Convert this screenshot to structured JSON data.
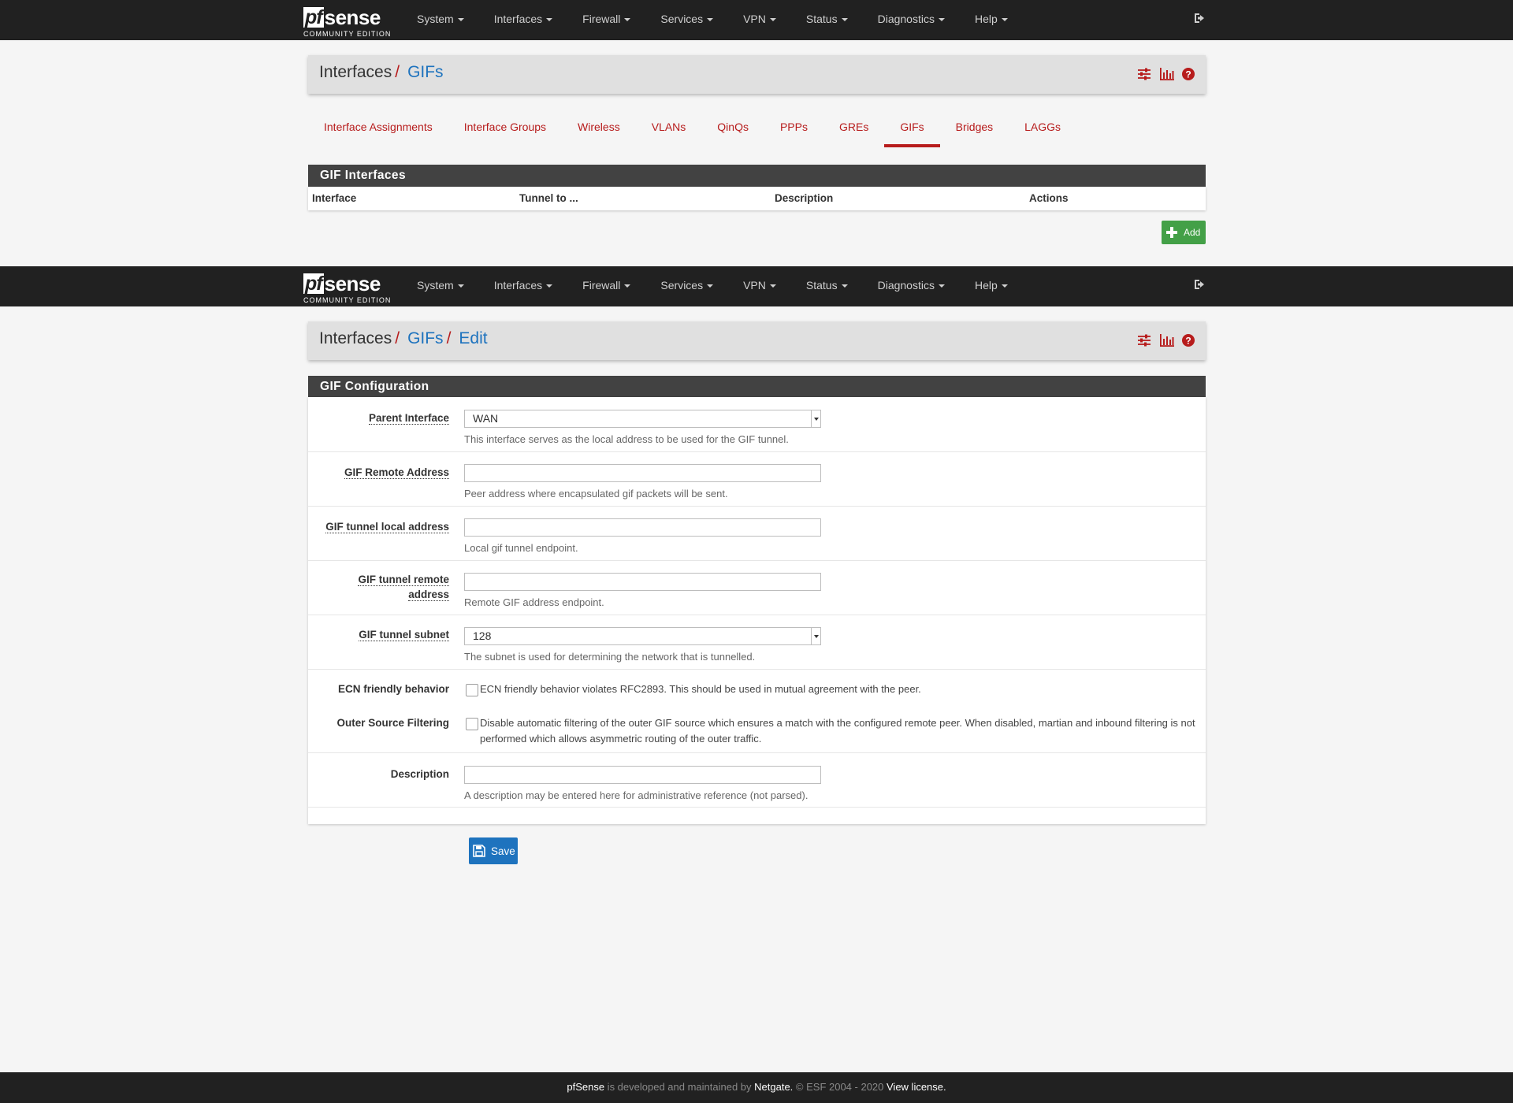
{
  "nav": {
    "brand_pf": "pf",
    "brand_sense": "sense",
    "brand_edition": "COMMUNITY EDITION",
    "menu": [
      "System",
      "Interfaces",
      "Firewall",
      "Services",
      "VPN",
      "Status",
      "Diagnostics",
      "Help"
    ]
  },
  "list_page": {
    "breadcrumb": {
      "root": "Interfaces",
      "sep": "/",
      "current": "GIFs"
    },
    "tabs": [
      "Interface Assignments",
      "Interface Groups",
      "Wireless",
      "VLANs",
      "QinQs",
      "PPPs",
      "GREs",
      "GIFs",
      "Bridges",
      "LAGGs"
    ],
    "active_tab": "GIFs",
    "panel_title": "GIF Interfaces",
    "columns": [
      "Interface",
      "Tunnel to ...",
      "Description",
      "Actions"
    ],
    "add_label": "Add"
  },
  "edit_page": {
    "breadcrumb": {
      "root": "Interfaces",
      "sep": "/",
      "mid": "GIFs",
      "current": "Edit"
    },
    "panel_title": "GIF Configuration",
    "fields": {
      "parent_interface": {
        "label": "Parent Interface",
        "value": "WAN",
        "help": "This interface serves as the local address to be used for the GIF tunnel."
      },
      "remote_address": {
        "label": "GIF Remote Address",
        "value": "",
        "help": "Peer address where encapsulated gif packets will be sent."
      },
      "tunnel_local": {
        "label": "GIF tunnel local address",
        "value": "",
        "help": "Local gif tunnel endpoint."
      },
      "tunnel_remote": {
        "label_1": "GIF tunnel remote",
        "label_2": "address",
        "value": "",
        "help": "Remote GIF address endpoint."
      },
      "tunnel_subnet": {
        "label": "GIF tunnel subnet",
        "value": "128",
        "help": "The subnet is used for determining the network that is tunnelled."
      },
      "ecn": {
        "label": "ECN friendly behavior",
        "text": "ECN friendly behavior violates RFC2893. This should be used in mutual agreement with the peer.",
        "checked": false
      },
      "outer_filter": {
        "label": "Outer Source Filtering",
        "text": "Disable automatic filtering of the outer GIF source which ensures a match with the configured remote peer. When disabled, martian and inbound filtering is not performed which allows asymmetric routing of the outer traffic.",
        "checked": false
      },
      "description": {
        "label": "Description",
        "value": "",
        "help": "A description may be entered here for administrative reference (not parsed)."
      }
    },
    "save_label": "Save"
  },
  "footer": {
    "brand": "pfSense",
    "text1": " is developed and maintained by ",
    "company": "Netgate.",
    "text2": " © ESF 2004 - 2020 ",
    "license": "View license."
  },
  "colors": {
    "navbar": "#212121",
    "accent_red": "#b71c1c",
    "link_blue": "#1e73be",
    "add_green": "#43a047",
    "panel_head": "#424242"
  },
  "icons": [
    "sliders-icon",
    "bar-chart-icon",
    "help-icon",
    "logout-icon",
    "plus-icon",
    "save-icon"
  ]
}
